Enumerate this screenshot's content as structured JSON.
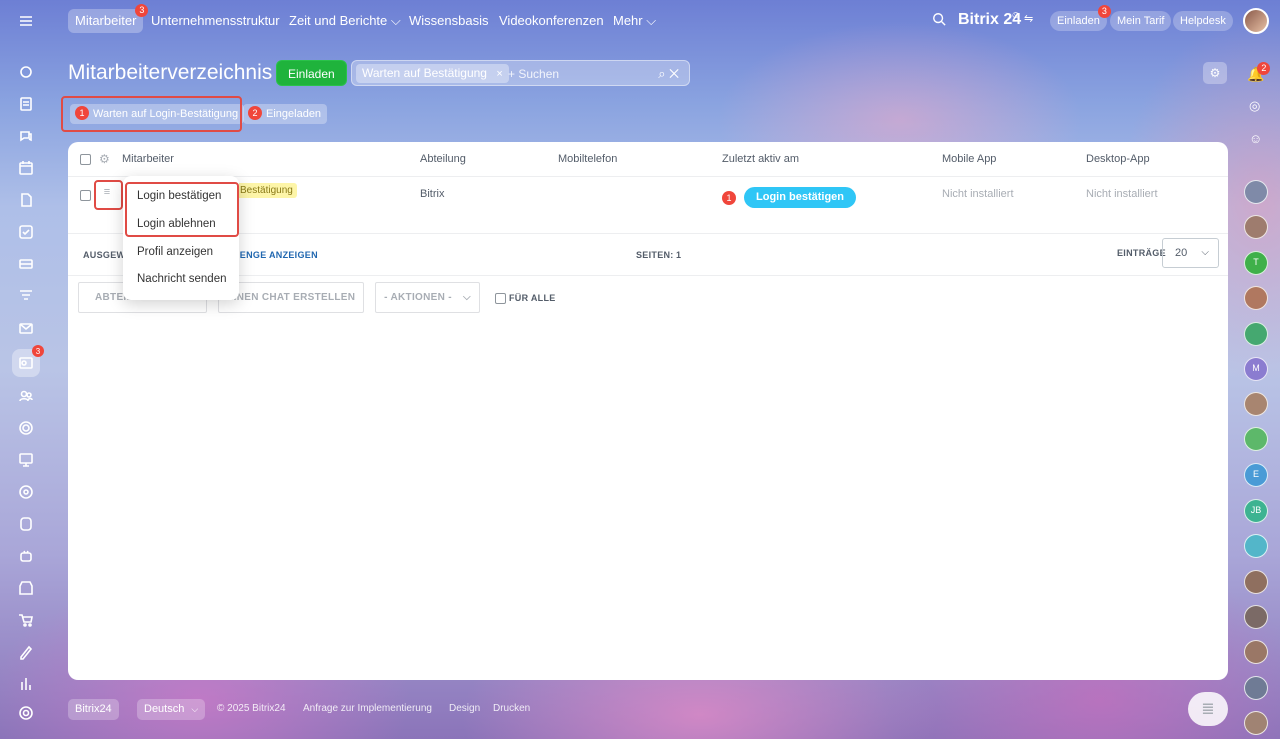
{
  "topnav": {
    "items": [
      {
        "label": "Mitarbeiter",
        "badge": "3"
      },
      {
        "label": "Unternehmensstruktur"
      },
      {
        "label": "Zeit und Berichte ⌵"
      },
      {
        "label": "Wissensbasis"
      },
      {
        "label": "Videokonferenzen"
      },
      {
        "label": "Mehr ⌵"
      }
    ],
    "brand": "Bitrix 24",
    "invite_label": "Einladen",
    "invite_badge": "3",
    "tariff_label": "Mein Tarif",
    "helpdesk_label": "Helpdesk"
  },
  "left_rail": {
    "badge": "3",
    "icons": [
      "menu-icon",
      "activity-icon",
      "feed-icon",
      "chat-icon",
      "calendar-icon",
      "document-icon",
      "task-icon",
      "crm-icon",
      "funnel-icon",
      "mail-icon",
      "employees-icon",
      "groups-icon",
      "automation-icon",
      "whiteboard-icon",
      "goal-icon",
      "box-icon",
      "robot-icon",
      "store-icon",
      "cart-icon",
      "sign-icon",
      "analytics-icon",
      "settings-icon"
    ]
  },
  "header": {
    "title": "Mitarbeiterverzeichnis",
    "invite_button": "Einladen",
    "search_tag": "Warten auf Bestätigung",
    "search_placeholder": "+ Suchen"
  },
  "filters": [
    {
      "num": "1",
      "label": "Warten auf Login-Bestätigung"
    },
    {
      "num": "2",
      "label": "Eingeladen"
    }
  ],
  "table": {
    "columns": [
      "Mitarbeiter",
      "Abteilung",
      "Mobiltelefon",
      "Zuletzt aktiv am",
      "Mobile App",
      "Desktop-App"
    ],
    "row": {
      "status": "Bestätigung",
      "department": "Bitrix",
      "step_num": "1",
      "login_button": "Login bestätigen",
      "mobile_app": "Nicht installiert",
      "desktop_app": "Nicht installiert"
    },
    "footer": {
      "selected_prefix": "AUSGEWÄ",
      "show_count": "MENGE ANZEIGEN",
      "pages_label": "SEITEN:",
      "pages_value": "1",
      "entries_label": "EINTRÄGE",
      "entries_value": "20"
    },
    "actions": {
      "department_btn": "ABTEIL",
      "chat_btn": "EINEN CHAT ERSTELLEN",
      "actions_select": "- AKTIONEN -",
      "for_all": "FÜR ALLE"
    }
  },
  "context_menu": [
    "Login bestätigen",
    "Login ablehnen",
    "Profil anzeigen",
    "Nachricht senden"
  ],
  "right_rail": {
    "notif_badge": "2",
    "avatars": [
      "",
      "",
      "T",
      "",
      "",
      "M",
      "",
      "",
      "E",
      "JB",
      "",
      "",
      "",
      "",
      "",
      ""
    ]
  },
  "bottom": {
    "logo": "Bitrix24",
    "language": "Deutsch",
    "copyright": "© 2025 Bitrix24",
    "links": [
      "Anfrage zur Implementierung",
      "Design",
      "Drucken"
    ]
  }
}
